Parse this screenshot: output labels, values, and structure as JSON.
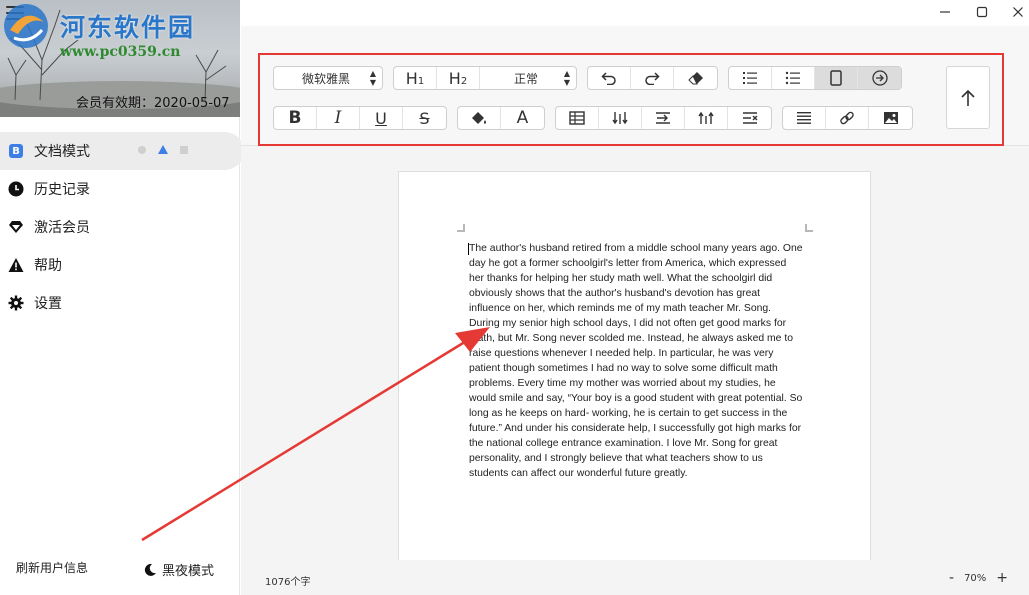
{
  "sidebar": {
    "watermark": {
      "site_name": "河东软件园",
      "url": "www.pc0359.cn"
    },
    "vip_expire": "会员有效期：2020-05-07",
    "nav": [
      {
        "label": "文档模式",
        "icon": "doc-badge-icon",
        "badge": "B",
        "active": true
      },
      {
        "label": "历史记录",
        "icon": "clock-icon",
        "active": false
      },
      {
        "label": "激活会员",
        "icon": "diamond-icon",
        "active": false
      },
      {
        "label": "帮助",
        "icon": "warning-icon",
        "active": false
      },
      {
        "label": "设置",
        "icon": "gear-icon",
        "active": false
      }
    ],
    "refresh_label": "刷新用户信息",
    "night_mode_label": "黑夜模式"
  },
  "toolbar": {
    "font_family": "微软雅黑",
    "heading1": "H1",
    "heading2": "H2",
    "paragraph_style": "正常"
  },
  "document": {
    "body": "The author's husband retired from a middle school many years ago. One day he got a former schoolgirl's letter from America, which expressed her thanks for helping her study math well. What the schoolgirl did obviously shows that the author's husband's devotion has great influence on her, which reminds me of my math teacher Mr. Song. During my senior high school days, I did not often get good marks for math, but Mr. Song never scolded me. Instead, he always asked me to raise questions whenever I needed help. In particular, he was very patient though sometimes I had no way to solve some difficult math problems. Every time my mother was worried about my studies, he would smile and say, “Your boy is a good student with great potential. So long as he keeps on hard- working, he is certain to get success in the future.” And under his considerate help, I successfully got high marks for the national college entrance examination. I love Mr. Song for great personality, and I strongly believe that what teachers show to us students can affect our wonderful future greatly."
  },
  "status": {
    "word_count": "1076个字",
    "zoom_minus": "-",
    "zoom_level": "70%",
    "zoom_plus": "+"
  },
  "colors": {
    "accent": "#3d7fe6",
    "annotation_red": "#e53935",
    "watermark_blue": "#2a76c9",
    "watermark_green": "#2f8a2f"
  }
}
